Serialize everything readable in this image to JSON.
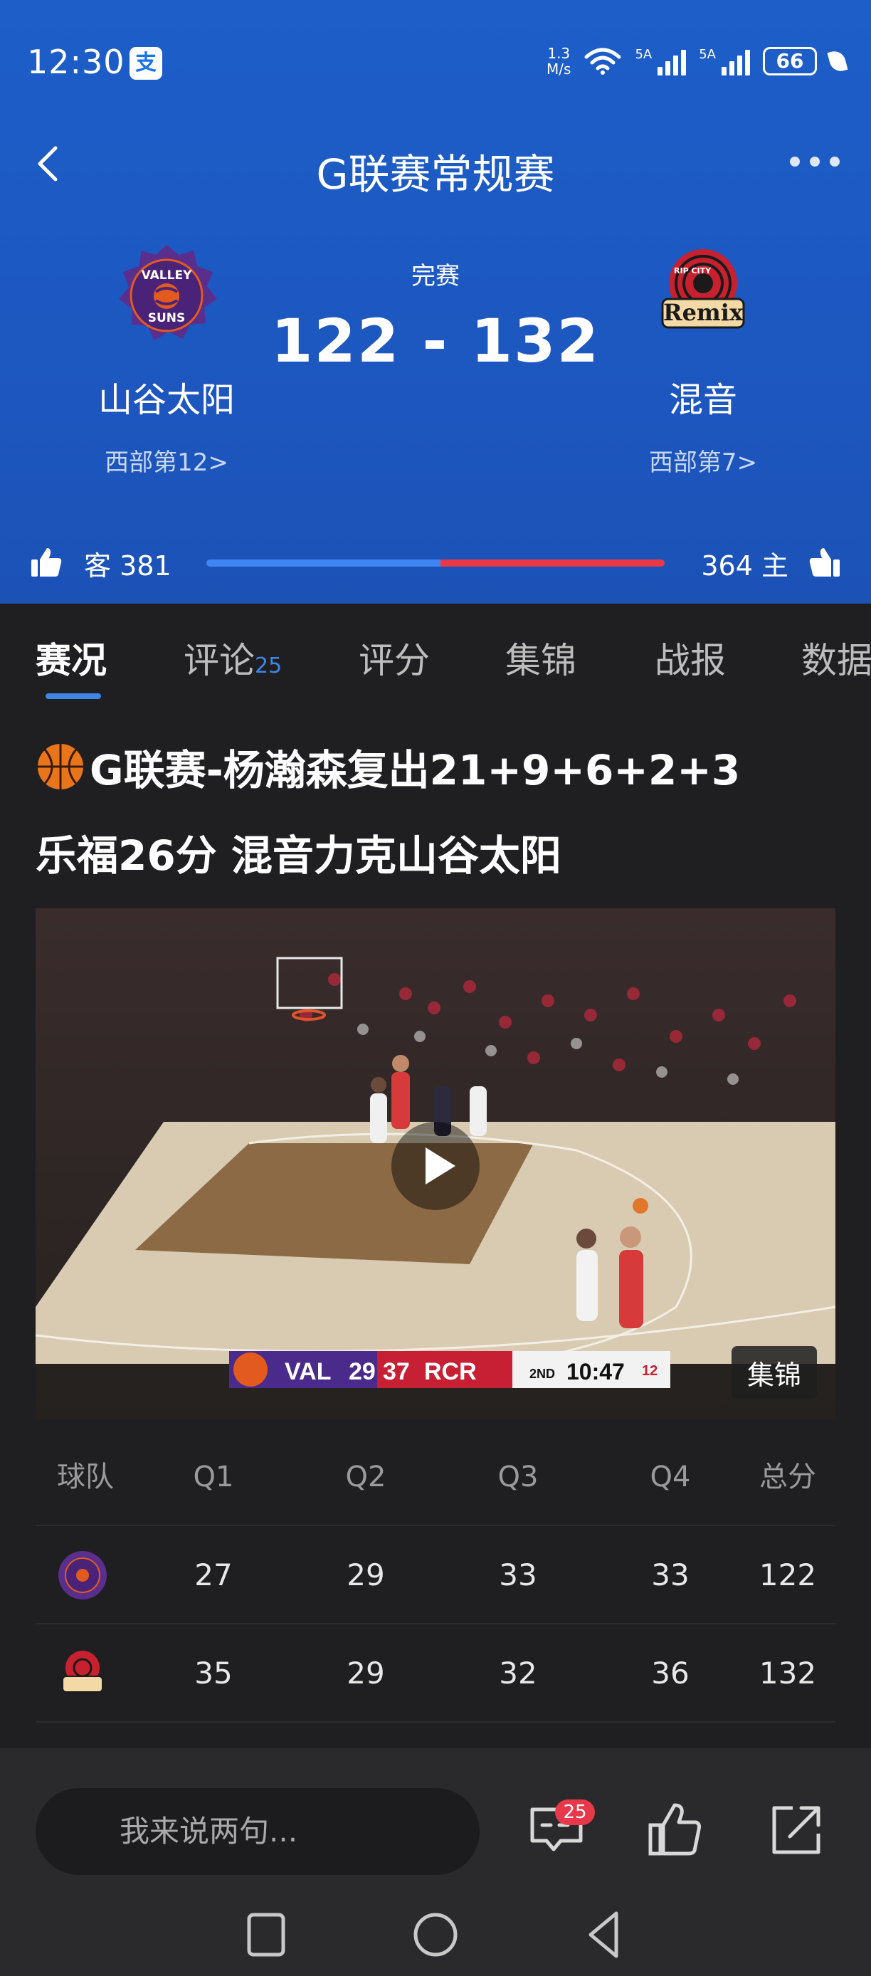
{
  "status_bar": {
    "time": "12:30",
    "alipay_label": "支",
    "net_speed_value": "1.3",
    "net_speed_unit": "M/s",
    "signal1_label": "5A",
    "signal2_label": "5A",
    "battery": "66"
  },
  "nav": {
    "title": "G联赛常规赛"
  },
  "game": {
    "status": "完赛",
    "score": "122 - 132",
    "away": {
      "name": "山谷太阳",
      "rank": "西部第12>",
      "logo_text_top": "VALLEY",
      "logo_text_bottom": "SUNS"
    },
    "home": {
      "name": "混音",
      "rank": "西部第7>",
      "logo_text_top": "RIP CITY",
      "logo_text_bottom": "Remix"
    }
  },
  "votes": {
    "away_label": "客 381",
    "home_label": "364 主",
    "away_count": 381,
    "home_count": 364
  },
  "tabs": [
    {
      "label": "赛况",
      "active": true,
      "count": ""
    },
    {
      "label": "评论",
      "active": false,
      "count": "25"
    },
    {
      "label": "评分",
      "active": false,
      "count": ""
    },
    {
      "label": "集锦",
      "active": false,
      "count": ""
    },
    {
      "label": "战报",
      "active": false,
      "count": ""
    },
    {
      "label": "数据",
      "active": false,
      "count": ""
    }
  ],
  "headline": {
    "line1": "G联赛-杨瀚森复出21+9+6+2+3",
    "line2": "乐福26分 混音力克山谷太阳"
  },
  "video": {
    "tag": "集锦",
    "scorebug": {
      "away_abbr": "VAL",
      "away_score": "29",
      "home_score": "37",
      "home_abbr": "RCR",
      "period": "2ND",
      "clock": "10:47",
      "shot_clock": "12"
    }
  },
  "quarter_table": {
    "headers": [
      "球队",
      "Q1",
      "Q2",
      "Q3",
      "Q4",
      "总分"
    ],
    "rows": [
      {
        "team": "山谷太阳",
        "values": [
          "27",
          "29",
          "33",
          "33",
          "122"
        ]
      },
      {
        "team": "混音",
        "values": [
          "35",
          "29",
          "32",
          "36",
          "132"
        ]
      }
    ]
  },
  "bottom_bar": {
    "input_placeholder": "我来说两句...",
    "comment_badge": "25"
  },
  "colors": {
    "header_blue": "#1d5ec9",
    "away_vote": "#3f86f2",
    "home_vote": "#e8394a",
    "tab_indicator": "#3d86e6"
  }
}
